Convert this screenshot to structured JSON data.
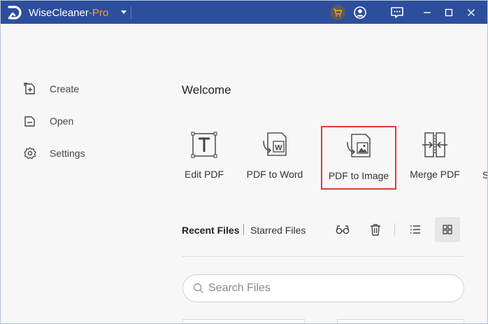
{
  "titlebar": {
    "app_name": "WiseCleaner",
    "app_suffix": "-Pro",
    "accent_color": "#2c4e9c",
    "pro_color": "#f5a623",
    "icons": [
      "cart-icon",
      "user-icon",
      "feedback-icon",
      "minimize-icon",
      "maximize-icon",
      "close-icon"
    ]
  },
  "sidebar": {
    "items": [
      {
        "label": "Create",
        "icon": "create-icon"
      },
      {
        "label": "Open",
        "icon": "folder-icon"
      },
      {
        "label": "Settings",
        "icon": "gear-icon"
      }
    ]
  },
  "main": {
    "welcome": "Welcome",
    "tools": [
      {
        "label": "Edit PDF",
        "icon": "edit-pdf-icon"
      },
      {
        "label": "PDF to Word",
        "icon": "pdf-to-word-icon"
      },
      {
        "label": "PDF to Image",
        "icon": "pdf-to-image-icon",
        "highlighted": true
      },
      {
        "label": "Merge PDF",
        "icon": "merge-pdf-icon"
      },
      {
        "label": "S",
        "icon": ""
      }
    ],
    "tabs": {
      "recent": "Recent Files",
      "starred": "Starred Files"
    },
    "search": {
      "placeholder": "Search Files"
    }
  }
}
